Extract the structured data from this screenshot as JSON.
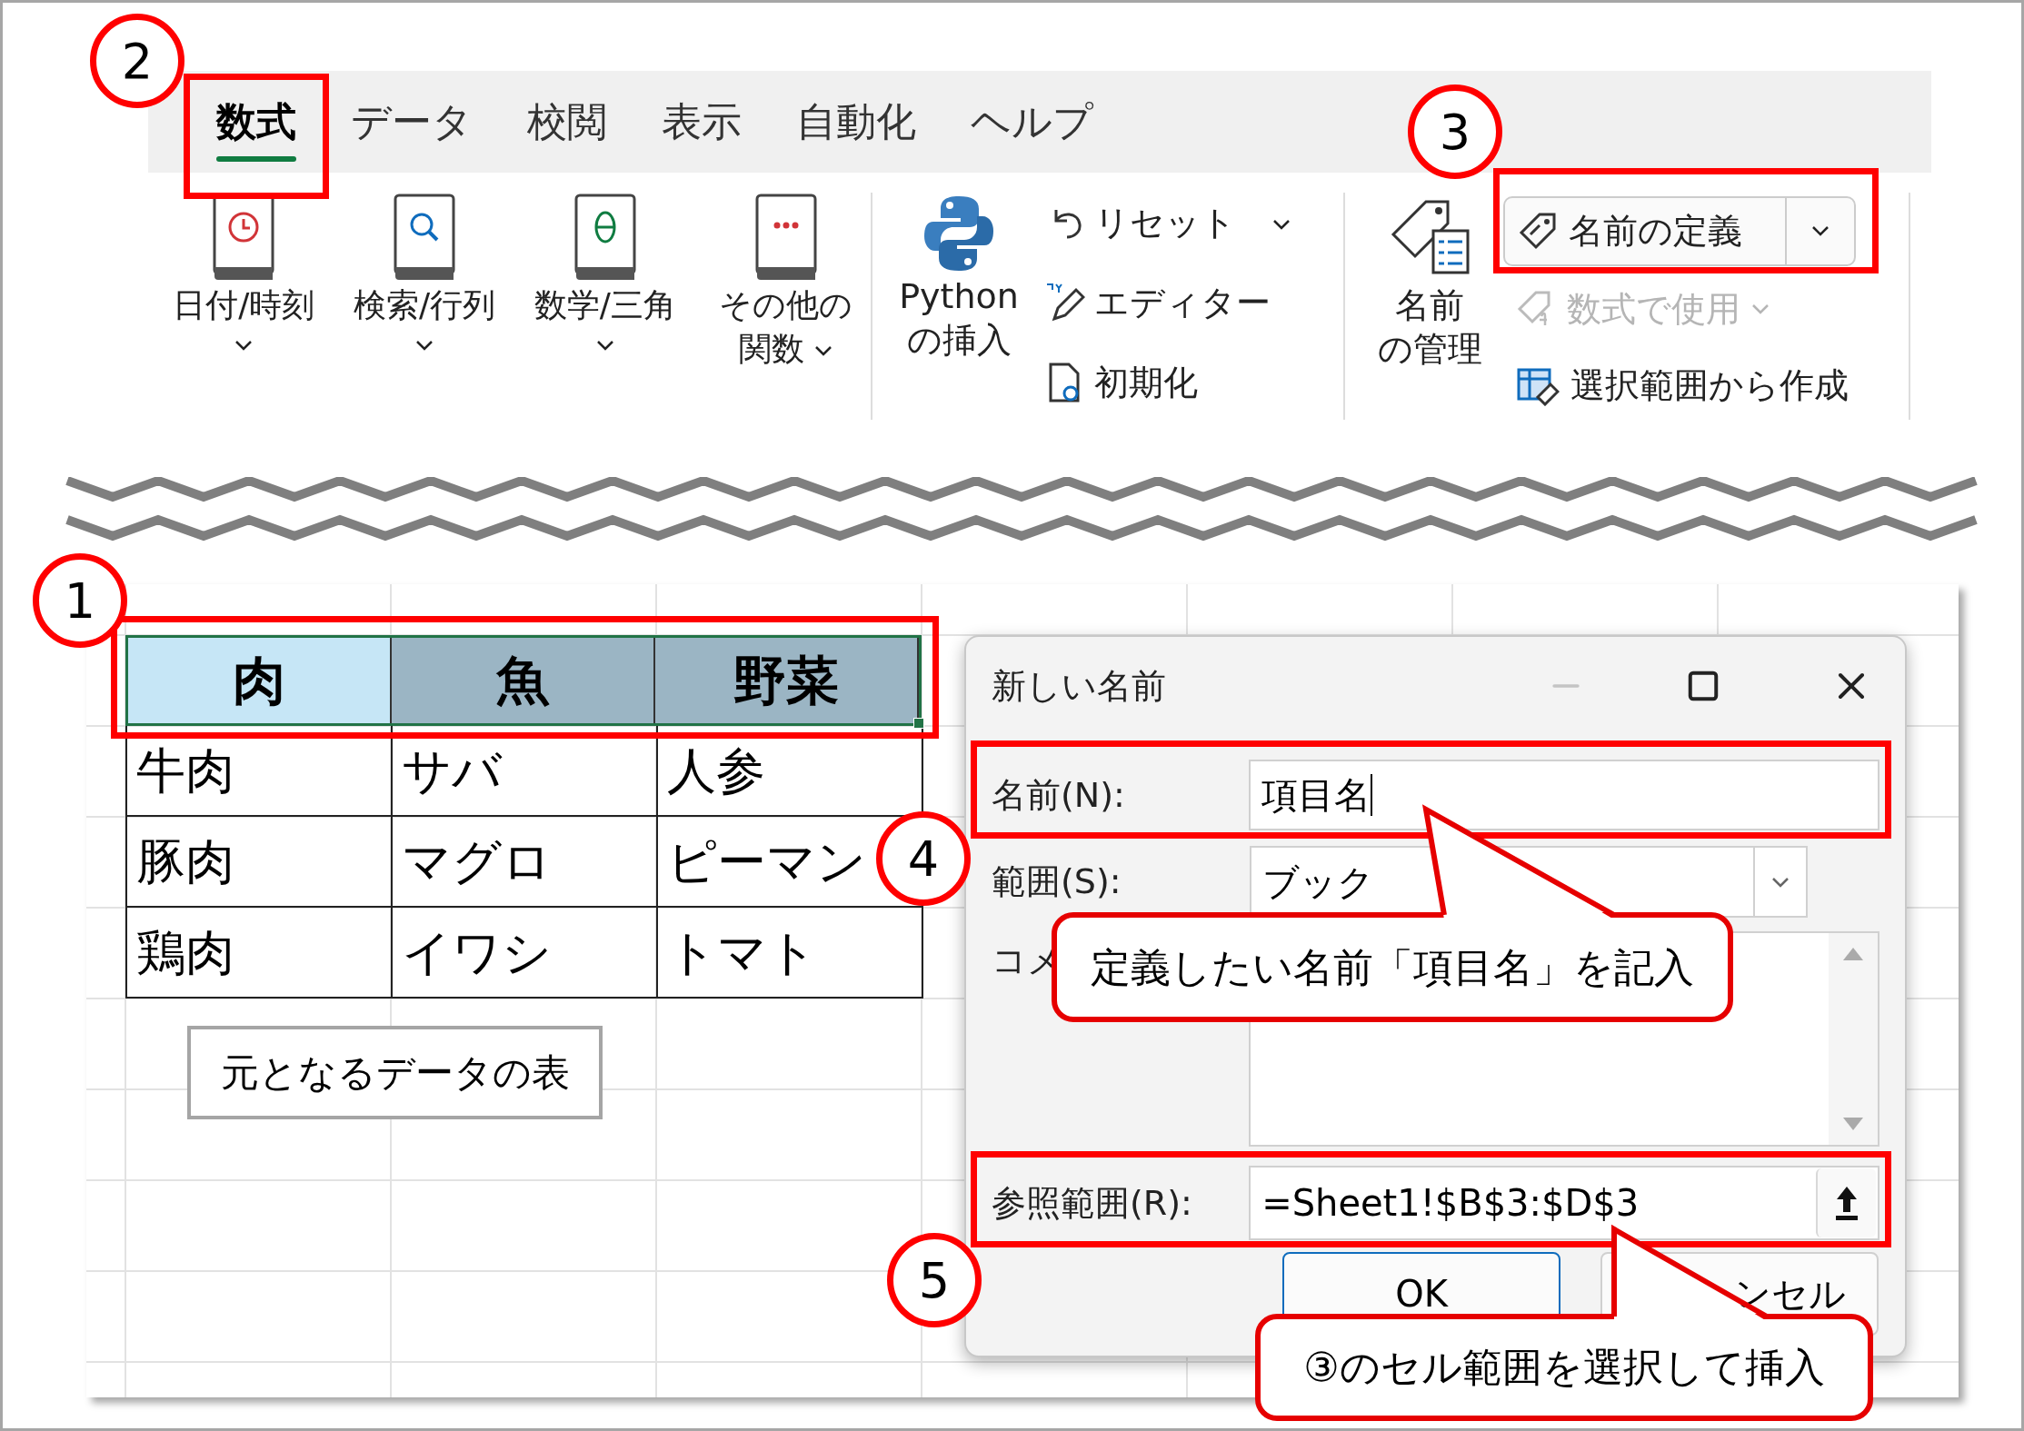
{
  "ribbon": {
    "tabs": [
      {
        "label": "数式",
        "selected": true
      },
      {
        "label": "データ",
        "selected": false
      },
      {
        "label": "校閲",
        "selected": false
      },
      {
        "label": "表示",
        "selected": false
      },
      {
        "label": "自動化",
        "selected": false
      },
      {
        "label": "ヘルプ",
        "selected": false
      }
    ],
    "function_buttons": [
      {
        "lines": [
          "日付/時刻"
        ],
        "menu": true
      },
      {
        "lines": [
          "検索/行列"
        ],
        "menu": true
      },
      {
        "lines": [
          "数学/三角"
        ],
        "menu": true
      },
      {
        "lines": [
          "その他の",
          "関数"
        ],
        "menu": true
      }
    ],
    "python": {
      "insert_lines": [
        "Python",
        "の挿入"
      ],
      "small_buttons": [
        {
          "label": "リセット",
          "menu": true
        },
        {
          "label": "エディター",
          "menu": false
        },
        {
          "label": "初期化",
          "menu": false
        }
      ]
    },
    "names": {
      "manager_lines": [
        "名前",
        "の管理"
      ],
      "small_buttons": [
        {
          "kind": "split",
          "label": "名前の定義",
          "disabled": false,
          "menu": true
        },
        {
          "kind": "plain",
          "label": "数式で使用",
          "disabled": true,
          "menu": true
        },
        {
          "kind": "plain",
          "label": "選択範囲から作成",
          "disabled": false,
          "menu": false
        }
      ]
    }
  },
  "sheet": {
    "header": [
      {
        "label": "肉",
        "active": true
      },
      {
        "label": "魚",
        "active": false
      },
      {
        "label": "野菜",
        "active": false
      }
    ],
    "rows": [
      [
        "牛肉",
        "サバ",
        "人参"
      ],
      [
        "豚肉",
        "マグロ",
        "ピーマン"
      ],
      [
        "鶏肉",
        "イワシ",
        "トマト"
      ]
    ],
    "note": "元となるデータの表"
  },
  "dialog": {
    "title": "新しい名前",
    "name_field": {
      "label": "名前(N):",
      "value": "項目名"
    },
    "scope_field": {
      "label": "範囲(S):",
      "value": "ブック"
    },
    "comment_field": {
      "label": "コメ"
    },
    "reference_field": {
      "label": "参照範囲(R):",
      "value": "=Sheet1!$B$3:$D$3"
    },
    "buttons": [
      {
        "label": "OK",
        "default": true
      },
      {
        "label": "ンセル",
        "default": false
      }
    ]
  },
  "annotations": {
    "markers": [
      "1",
      "2",
      "3",
      "4",
      "5"
    ],
    "callouts": [
      "定義したい名前「項目名」を記入",
      "③のセル範囲を選択して挿入"
    ]
  }
}
